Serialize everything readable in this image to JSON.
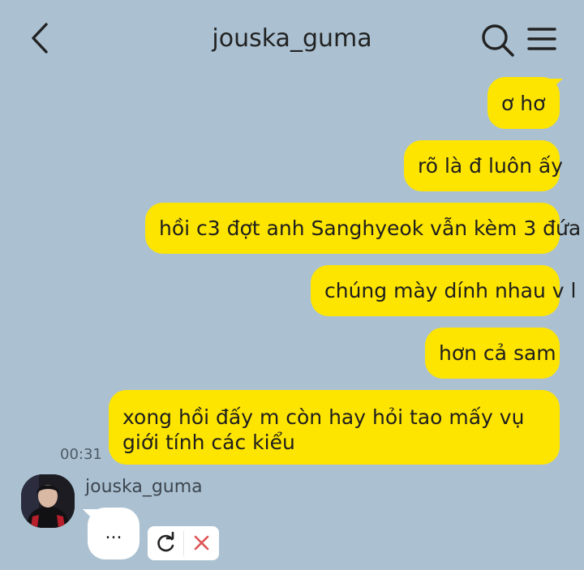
{
  "header": {
    "title": "jouska_guma"
  },
  "messages": [
    {
      "text": "ơ hơ"
    },
    {
      "text": "rõ là đ luôn ấy"
    },
    {
      "text": "hồi c3 đợt anh Sanghyeok vẫn kèm 3 đứa"
    },
    {
      "text": "chúng mày dính nhau v l"
    },
    {
      "text": "hơn cả sam"
    },
    {
      "text": "xong hồi đấy m còn hay hỏi tao mấy vụ giới tính các kiểu"
    }
  ],
  "last_message_time": "00:31",
  "incoming": {
    "sender": "jouska_guma",
    "typing_text": "..."
  },
  "colors": {
    "background": "#abc1d1",
    "outgoing_bubble": "#fee500",
    "incoming_bubble": "#ffffff",
    "delete_icon": "#e05555"
  },
  "icons": [
    "back-arrow-icon",
    "search-icon",
    "menu-icon",
    "retry-icon",
    "delete-icon"
  ]
}
